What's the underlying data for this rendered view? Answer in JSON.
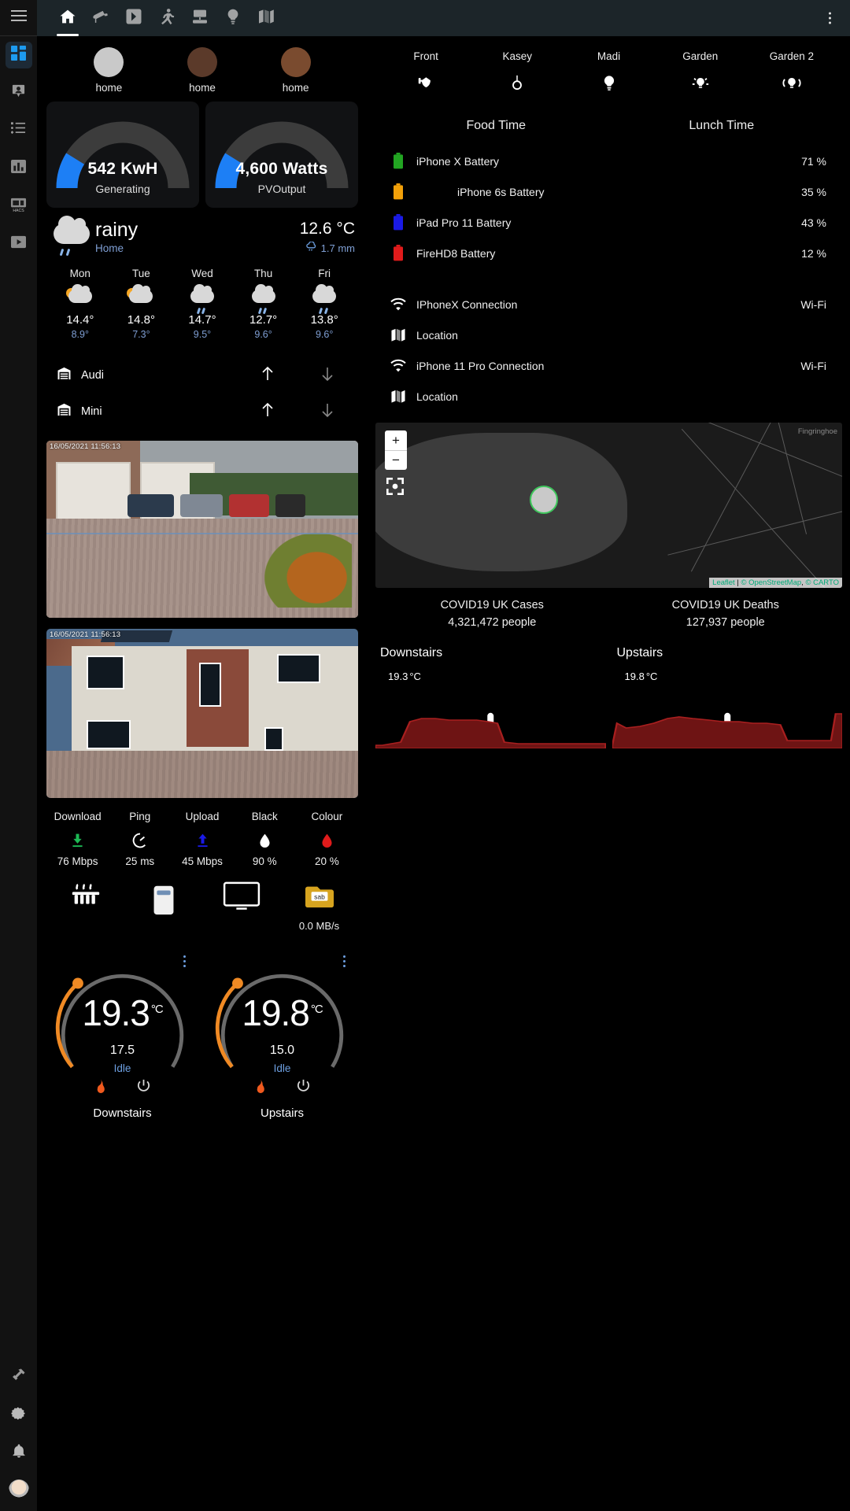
{
  "topbar": {
    "menu_icon": "hamburger-icon",
    "tabs": [
      {
        "name": "home",
        "icon": "home-icon",
        "active": true
      },
      {
        "name": "cameras",
        "icon": "cctv-camera-icon",
        "active": false
      },
      {
        "name": "media",
        "icon": "chevron-right-box-icon",
        "active": false
      },
      {
        "name": "motion",
        "icon": "running-person-icon",
        "active": false
      },
      {
        "name": "network",
        "icon": "server-network-icon",
        "active": false
      },
      {
        "name": "lights",
        "icon": "lightbulb-icon",
        "active": false
      },
      {
        "name": "map",
        "icon": "map-icon",
        "active": false
      }
    ],
    "overflow_icon": "kebab-menu-icon"
  },
  "sidebar": {
    "items": [
      {
        "name": "overview",
        "icon": "dashboard-grid-icon",
        "active": true
      },
      {
        "name": "people",
        "icon": "person-badge-icon",
        "active": false
      },
      {
        "name": "logbook",
        "icon": "list-icon",
        "active": false
      },
      {
        "name": "history",
        "icon": "bar-chart-icon",
        "active": false
      },
      {
        "name": "hacs",
        "icon": "hacs-store-icon",
        "active": false,
        "label": "HACS"
      },
      {
        "name": "media-browser",
        "icon": "media-play-icon",
        "active": false
      }
    ],
    "bottom": [
      {
        "name": "developer-tools",
        "icon": "hammer-icon"
      },
      {
        "name": "settings",
        "icon": "gear-icon"
      },
      {
        "name": "notifications",
        "icon": "bell-icon"
      },
      {
        "name": "user-profile",
        "icon": "avatar-icon"
      }
    ]
  },
  "persons": [
    {
      "name": "person-1",
      "state": "home",
      "avatar": "memoji-grandpa"
    },
    {
      "name": "person-2",
      "state": "home",
      "avatar": "memoji-woman-brown"
    },
    {
      "name": "person-3",
      "state": "home",
      "avatar": "memoji-woman-auburn"
    }
  ],
  "energy_gauges": [
    {
      "value": "542 KwH",
      "label": "Generating",
      "percent": 22,
      "color": "#1d7ff5"
    },
    {
      "value": "4,600 Watts",
      "label": "PVOutput",
      "percent": 22,
      "color": "#1d7ff5"
    }
  ],
  "weather": {
    "condition": "rainy",
    "location": "Home",
    "temperature": "12.6",
    "unit": "°C",
    "precipitation": "1.7 mm",
    "precip_icon": "rain-cloud-icon",
    "forecast": [
      {
        "day": "Mon",
        "icon": "partly-cloudy-icon",
        "high": "14.4°",
        "low": "8.9°"
      },
      {
        "day": "Tue",
        "icon": "partly-cloudy-icon",
        "high": "14.8°",
        "low": "7.3°"
      },
      {
        "day": "Wed",
        "icon": "rainy-icon",
        "high": "14.7°",
        "low": "9.5°"
      },
      {
        "day": "Thu",
        "icon": "rainy-icon",
        "high": "12.7°",
        "low": "9.6°"
      },
      {
        "day": "Fri",
        "icon": "rainy-icon",
        "high": "13.8°",
        "low": "9.6°"
      }
    ]
  },
  "garage": [
    {
      "name": "Audi",
      "icon": "garage-icon",
      "up_icon": "arrow-up-icon",
      "down_icon": "arrow-down-icon"
    },
    {
      "name": "Mini",
      "icon": "garage-icon",
      "up_icon": "arrow-up-icon",
      "down_icon": "arrow-down-icon"
    }
  ],
  "cameras": [
    {
      "name": "driveway-camera",
      "timestamp": "16/05/2021  11:56:13"
    },
    {
      "name": "front-house-camera",
      "timestamp": "16/05/2021  11:56:13"
    }
  ],
  "speedtest": [
    {
      "label": "Download",
      "icon": "download-arrow-icon",
      "value": "76 Mbps",
      "color": "#1db954"
    },
    {
      "label": "Ping",
      "icon": "speedometer-icon",
      "value": "25 ms",
      "color": "#ffffff"
    },
    {
      "label": "Upload",
      "icon": "upload-arrow-icon",
      "value": "45 Mbps",
      "color": "#1a1ae6"
    },
    {
      "label": "Black",
      "icon": "ink-drop-icon",
      "value": "90 %",
      "color": "#ffffff"
    },
    {
      "label": "Colour",
      "icon": "ink-drop-icon",
      "value": "20 %",
      "color": "#e01b1b"
    }
  ],
  "device_row": [
    {
      "name": "heater",
      "icon": "radiator-icon",
      "caption": ""
    },
    {
      "name": "air-purifier",
      "icon": "air-purifier-icon",
      "caption": ""
    },
    {
      "name": "television",
      "icon": "tv-icon",
      "caption": ""
    },
    {
      "name": "sabnzbd",
      "icon": "sabnzbd-icon",
      "caption": "0.0 MB/s"
    }
  ],
  "climate": [
    {
      "name": "Downstairs",
      "current": "19.3",
      "unit": "°C",
      "target": "17.5",
      "state": "Idle",
      "percent": 68,
      "flame_icon": "flame-icon",
      "power_icon": "power-icon"
    },
    {
      "name": "Upstairs",
      "current": "19.8",
      "unit": "°C",
      "target": "15.0",
      "state": "Idle",
      "percent": 68,
      "flame_icon": "flame-icon",
      "power_icon": "power-icon"
    }
  ],
  "lights": [
    {
      "name": "Front",
      "icon": "outdoor-wall-light-icon"
    },
    {
      "name": "Kasey",
      "icon": "ceiling-light-icon"
    },
    {
      "name": "Madi",
      "icon": "lightbulb-icon"
    },
    {
      "name": "Garden",
      "icon": "garden-light-icon"
    },
    {
      "name": "Garden 2",
      "icon": "garden-light-group-icon"
    }
  ],
  "meals": [
    {
      "label": "Food Time"
    },
    {
      "label": "Lunch Time"
    }
  ],
  "entities": [
    {
      "name": "iPhone X Battery",
      "icon": "battery-icon",
      "color": "#22a522",
      "value": "71 %",
      "indent": false
    },
    {
      "name": "iPhone 6s Battery",
      "icon": "battery-icon",
      "color": "#f2a009",
      "value": "35 %",
      "indent": true
    },
    {
      "name": "iPad Pro 11 Battery",
      "icon": "battery-icon",
      "color": "#1a1ae6",
      "value": "43 %",
      "indent": false
    },
    {
      "name": "FireHD8 Battery",
      "icon": "battery-icon",
      "color": "#e01b1b",
      "value": "12 %",
      "indent": false
    }
  ],
  "connections": [
    {
      "name": "IPhoneX Connection",
      "icon": "wifi-icon",
      "value": "Wi-Fi"
    },
    {
      "name": "Location",
      "icon": "map-icon",
      "value": ""
    },
    {
      "name": "iPhone 11 Pro Connection",
      "icon": "wifi-icon",
      "value": "Wi-Fi"
    },
    {
      "name": "Location",
      "icon": "map-icon",
      "value": ""
    }
  ],
  "map": {
    "zoom_in": "+",
    "zoom_out": "−",
    "fullscreen_icon": "recenter-icon",
    "place_label": "Fingringhoe",
    "attribution_leaflet": "Leaflet",
    "attribution_osm": "© OpenStreetMap",
    "attribution_carto": "© CARTO",
    "marker": "memoji-grandpa"
  },
  "covid": [
    {
      "title": "COVID19 UK Cases",
      "value": "4,321,472 people"
    },
    {
      "title": "COVID19 UK Deaths",
      "value": "127,937 people"
    }
  ],
  "temp_sensors": [
    {
      "name": "Downstairs",
      "value": "19.3",
      "unit": "°C",
      "icon": "thermometer-icon"
    },
    {
      "name": "Upstairs",
      "value": "19.8",
      "unit": "°C",
      "icon": "thermometer-icon"
    }
  ],
  "chart_data": [
    {
      "type": "area",
      "title": "Downstairs",
      "ylabel": "°C",
      "x": [
        0,
        1,
        2,
        3,
        4,
        5,
        6,
        7,
        8,
        9,
        10,
        11,
        12,
        13,
        14,
        15,
        16,
        17,
        18,
        19
      ],
      "values": [
        18.4,
        18.4,
        18.5,
        18.6,
        19.4,
        19.6,
        19.6,
        19.5,
        19.5,
        19.5,
        19.4,
        19.4,
        18.6,
        18.5,
        18.5,
        18.5,
        18.5,
        18.5,
        18.5,
        18.5
      ],
      "color": "#8b1a1a",
      "ylim": [
        18.0,
        20.0
      ],
      "grid": false
    },
    {
      "type": "area",
      "title": "Upstairs",
      "ylabel": "°C",
      "x": [
        0,
        1,
        2,
        3,
        4,
        5,
        6,
        7,
        8,
        9,
        10,
        11,
        12,
        13,
        14,
        15,
        16,
        17,
        18,
        19
      ],
      "values": [
        18.4,
        19.5,
        19.2,
        19.3,
        19.4,
        19.6,
        19.7,
        19.6,
        19.5,
        19.4,
        19.4,
        19.3,
        19.3,
        19.2,
        19.2,
        18.6,
        18.6,
        18.6,
        18.6,
        19.8
      ],
      "color": "#8b1a1a",
      "ylim": [
        18.0,
        20.0
      ],
      "grid": false
    }
  ],
  "colors": {
    "accent": "#1d7ff5",
    "background": "#000000",
    "topbar": "#1c2529",
    "sidebar": "#121212",
    "card": "#111214",
    "secondary_text": "#7f9fd4"
  }
}
